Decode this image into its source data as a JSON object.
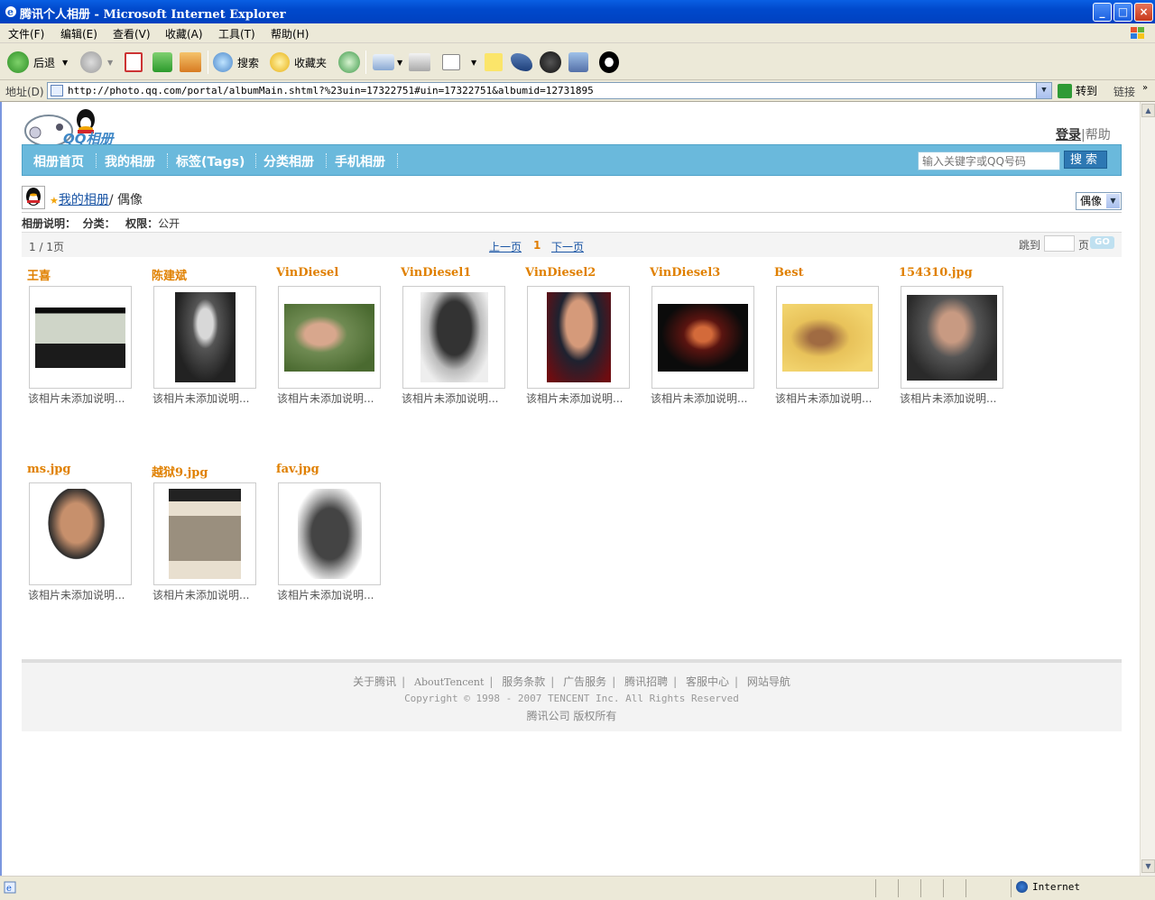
{
  "window": {
    "title": "腾讯个人相册 - Microsoft Internet Explorer",
    "min": "_",
    "max": "□",
    "close": "×"
  },
  "menu": [
    "文件(F)",
    "编辑(E)",
    "查看(V)",
    "收藏(A)",
    "工具(T)",
    "帮助(H)"
  ],
  "toolbar": {
    "back": "后退",
    "search": "搜索",
    "favorites": "收藏夹"
  },
  "address": {
    "label": "地址(D)",
    "url": "http://photo.qq.com/portal/albumMain.shtml?%23uin=17322751#uin=17322751&albumid=12731895",
    "go": "转到",
    "links": "链接"
  },
  "status": {
    "zone": "Internet"
  },
  "page": {
    "logo_text": "QQ相册",
    "login": "登录",
    "help": "帮助",
    "nav": [
      "相册首页",
      "我的相册",
      "标签(Tags)",
      "分类相册",
      "手机相册"
    ],
    "search_placeholder": "输入关键字或QQ号码",
    "search_button": "搜索",
    "crumb_link": "我的相册",
    "crumb_current": "/ 偶像",
    "album_select": "偶像",
    "meta": {
      "desc_label": "相册说明：",
      "cat_label": "分类：",
      "perm_label": "权限：",
      "perm_value": "公开"
    },
    "pager": {
      "count": "1 / 1页",
      "prev": "上一页",
      "current": "1",
      "next": "下一页",
      "jump": "跳到",
      "page": "页",
      "go": "GO"
    },
    "photos": [
      {
        "name": "王喜",
        "caption": "该相片未添加说明..."
      },
      {
        "name": "陈建斌",
        "caption": "该相片未添加说明..."
      },
      {
        "name": "VinDiesel",
        "caption": "该相片未添加说明..."
      },
      {
        "name": "VinDiesel1",
        "caption": "该相片未添加说明..."
      },
      {
        "name": "VinDiesel2",
        "caption": "该相片未添加说明..."
      },
      {
        "name": "VinDiesel3",
        "caption": "该相片未添加说明..."
      },
      {
        "name": "Best",
        "caption": "该相片未添加说明..."
      },
      {
        "name": "154310.jpg",
        "caption": "该相片未添加说明..."
      },
      {
        "name": "ms.jpg",
        "caption": "该相片未添加说明..."
      },
      {
        "name": "越狱9.jpg",
        "caption": "该相片未添加说明..."
      },
      {
        "name": "fav.jpg",
        "caption": "该相片未添加说明..."
      }
    ],
    "footer": {
      "links": [
        "关于腾讯",
        "AboutTencent",
        "服务条款",
        "广告服务",
        "腾讯招聘",
        "客服中心",
        "网站导航"
      ],
      "copyright": "Copyright © 1998 - 2007 TENCENT Inc. All Rights Reserved",
      "company": "腾讯公司 版权所有"
    }
  }
}
